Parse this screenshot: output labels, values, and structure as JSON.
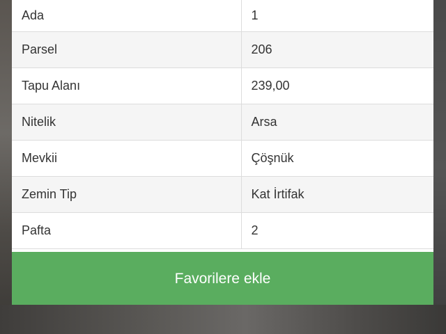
{
  "details": {
    "rows": [
      {
        "key": "Ada",
        "value": "1"
      },
      {
        "key": "Parsel",
        "value": "206"
      },
      {
        "key": "Tapu Alanı",
        "value": "239,00"
      },
      {
        "key": "Nitelik",
        "value": "Arsa"
      },
      {
        "key": "Mevkii",
        "value": "Çöşnük"
      },
      {
        "key": "Zemin Tip",
        "value": "Kat İrtifak"
      },
      {
        "key": "Pafta",
        "value": "2"
      }
    ]
  },
  "actions": {
    "favorite_label": "Favorilere ekle"
  },
  "colors": {
    "button": "#5aad5f",
    "row_alt": "#f5f5f5",
    "text": "#333333"
  }
}
